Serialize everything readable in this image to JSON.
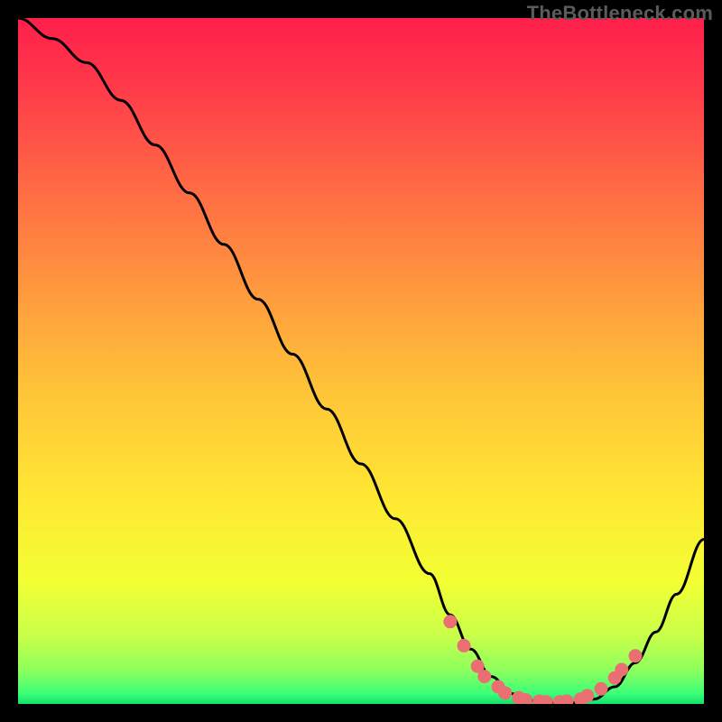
{
  "watermark": "TheBottleneck.com",
  "chart_data": {
    "type": "line",
    "title": "",
    "xlabel": "",
    "ylabel": "",
    "xlim": [
      0,
      100
    ],
    "ylim": [
      0,
      100
    ],
    "series": [
      {
        "name": "curve",
        "x": [
          0,
          5,
          10,
          15,
          20,
          25,
          30,
          35,
          40,
          45,
          50,
          55,
          60,
          63,
          66,
          69,
          72,
          75,
          78,
          81,
          84,
          87,
          90,
          93,
          96,
          100
        ],
        "y": [
          100,
          97,
          93.5,
          88,
          81.5,
          74.5,
          67,
          59,
          51,
          43,
          35,
          27,
          19,
          13,
          8,
          4,
          1.5,
          0.5,
          0.2,
          0.2,
          0.7,
          2.5,
          6,
          10.5,
          16,
          24
        ]
      }
    ],
    "optimal_region": {
      "name": "optimal-dots",
      "x": [
        63,
        65,
        67,
        68,
        70,
        71,
        73,
        74,
        76,
        77,
        79,
        80,
        82,
        83,
        85,
        87,
        88,
        90
      ],
      "y": [
        12,
        8.5,
        5.5,
        4,
        2.5,
        1.6,
        0.9,
        0.6,
        0.4,
        0.3,
        0.3,
        0.4,
        0.7,
        1.2,
        2.2,
        3.8,
        5,
        7
      ]
    },
    "gradient_stops": [
      {
        "offset": 0.0,
        "color": "#ff1f4b"
      },
      {
        "offset": 0.1,
        "color": "#ff3a4a"
      },
      {
        "offset": 0.25,
        "color": "#ff6b44"
      },
      {
        "offset": 0.4,
        "color": "#ff9a3e"
      },
      {
        "offset": 0.55,
        "color": "#ffc638"
      },
      {
        "offset": 0.7,
        "color": "#ffe733"
      },
      {
        "offset": 0.82,
        "color": "#f3ff33"
      },
      {
        "offset": 0.9,
        "color": "#c9ff49"
      },
      {
        "offset": 0.95,
        "color": "#8fff5c"
      },
      {
        "offset": 0.985,
        "color": "#3bff78"
      },
      {
        "offset": 1.0,
        "color": "#14e06a"
      }
    ],
    "colors": {
      "curve": "#000000",
      "dots": "#e96f73",
      "background_border": "#000000"
    }
  }
}
